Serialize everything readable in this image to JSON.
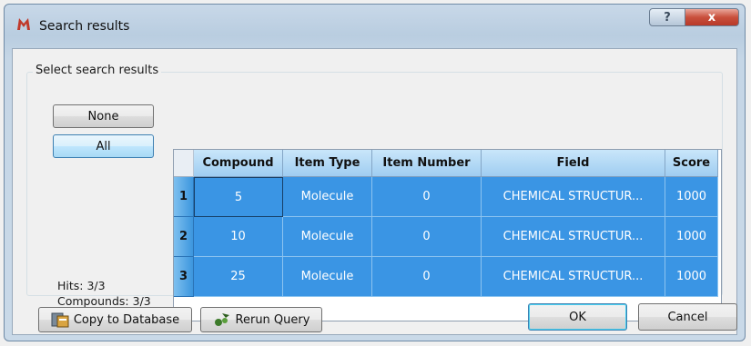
{
  "window": {
    "title": "Search results",
    "help_glyph": "?",
    "close_glyph": "x"
  },
  "group": {
    "label": "Select search results"
  },
  "buttons": {
    "none": "None",
    "all": "All",
    "copy": "Copy to Database",
    "rerun": "Rerun Query",
    "ok": "OK",
    "cancel": "Cancel"
  },
  "stats": {
    "hits": "Hits: 3/3",
    "compounds": "Compounds: 3/3"
  },
  "table": {
    "headers": [
      "Compound",
      "Item Type",
      "Item Number",
      "Field",
      "Score"
    ],
    "rows": [
      {
        "num": "1",
        "cells": [
          "5",
          "Molecule",
          "0",
          "CHEMICAL STRUCTUR...",
          "1000"
        ]
      },
      {
        "num": "2",
        "cells": [
          "10",
          "Molecule",
          "0",
          "CHEMICAL STRUCTUR...",
          "1000"
        ]
      },
      {
        "num": "3",
        "cells": [
          "25",
          "Molecule",
          "0",
          "CHEMICAL STRUCTUR...",
          "1000"
        ]
      }
    ]
  },
  "colors": {
    "selection": "#3a95e4",
    "header": "#b5dcf7",
    "close": "#c9503c"
  },
  "icons": {
    "app": "app-logo-icon",
    "copy": "database-copy-icon",
    "rerun": "rerun-query-icon"
  }
}
